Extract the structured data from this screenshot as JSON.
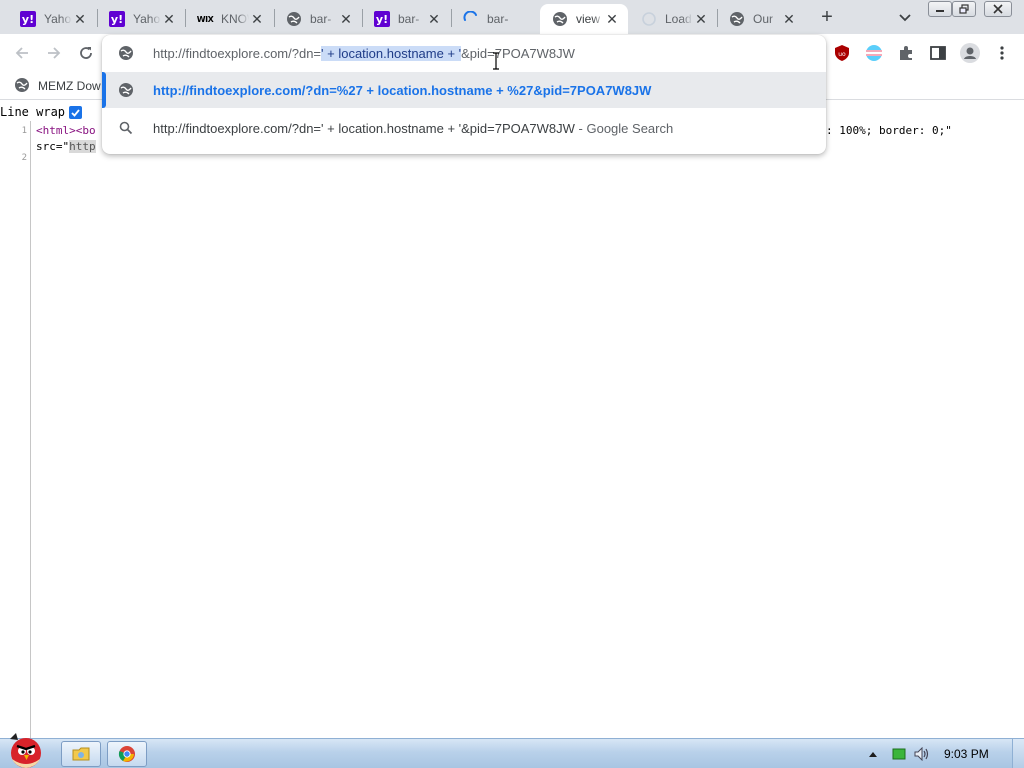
{
  "tabs": [
    {
      "title": "Yahoo",
      "favicon": "yahoo-icon",
      "active": false
    },
    {
      "title": "Yahoo",
      "favicon": "yahoo-icon",
      "active": false
    },
    {
      "title": "KNOW",
      "favicon": "wix-icon",
      "active": false
    },
    {
      "title": "bar-",
      "favicon": "globe-icon",
      "active": false
    },
    {
      "title": "bar-",
      "favicon": "yahoo-icon",
      "active": false
    },
    {
      "title": "bar-",
      "favicon": "loading-spinner-icon",
      "active": false
    },
    {
      "title": "view",
      "favicon": "globe-icon",
      "active": true
    },
    {
      "title": "Load",
      "favicon": "loading-spinner-icon",
      "active": false
    },
    {
      "title": "Our",
      "favicon": "globe-icon",
      "active": false
    }
  ],
  "favicon_glyphs": {
    "yahoo": "y!",
    "wix": "WIX"
  },
  "bookmarks": [
    {
      "label": "MEMZ Dow"
    }
  ],
  "viewsource": {
    "line_wrap_label": "Line wrap",
    "line_wrap_checked": true,
    "line_numbers": [
      "1",
      "2"
    ],
    "line1_start": "<html><bo",
    "line1_end": ": 100%; border: 0;\"",
    "line1_cont_prefix": "src=\"",
    "line1_cont_link": "http"
  },
  "omnibox": {
    "input_before": "http://findtoexplore.com/?dn=",
    "input_selected": "' + location.hostname + '",
    "input_after": "&pid=7POA7W8JW",
    "suggestions": [
      {
        "text": "http://findtoexplore.com/?dn=%27 + location.hostname + %27&pid=7POA7W8JW",
        "suffix": "",
        "icon": "globe-icon",
        "selected": true
      },
      {
        "text": "http://findtoexplore.com/?dn=' + location.hostname + '&pid=7POA7W8JW",
        "suffix": " - Google Search",
        "icon": "search-icon",
        "selected": false
      }
    ]
  },
  "taskbar": {
    "clock": "9:03 PM"
  },
  "colors": {
    "accent": "#1a73e8",
    "selection": "#cbdcf7",
    "tabstrip": "#dee1e6",
    "yahoo": "#6001d2"
  }
}
